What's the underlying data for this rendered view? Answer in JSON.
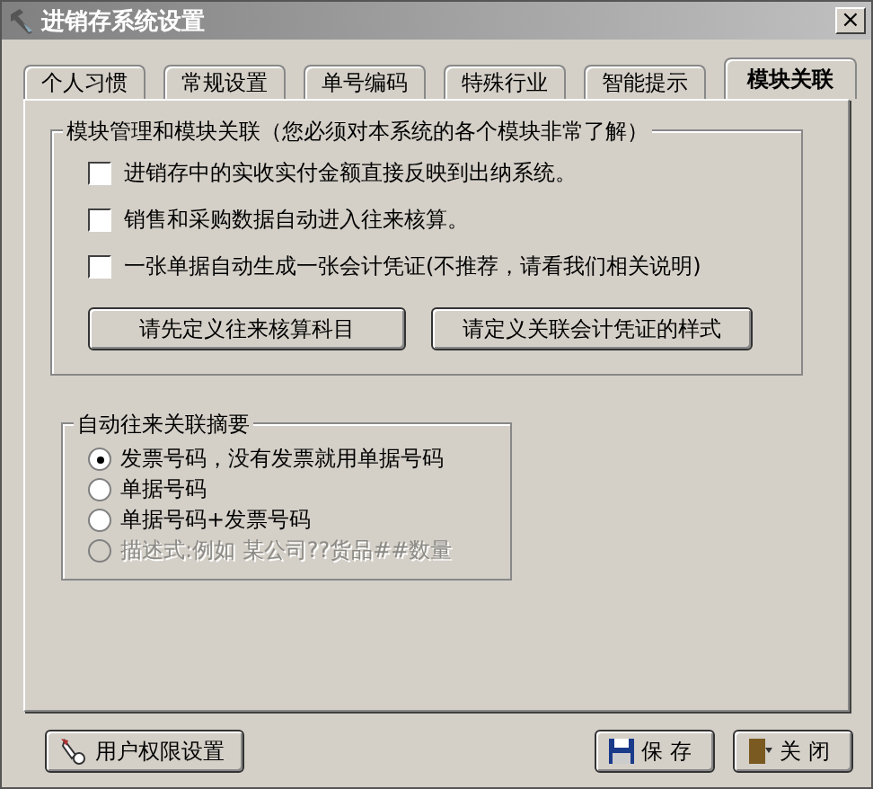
{
  "window": {
    "title": "进销存系统设置",
    "close": "×"
  },
  "tabs": [
    {
      "label": "个人习惯",
      "selected": false
    },
    {
      "label": "常规设置",
      "selected": false
    },
    {
      "label": "单号编码",
      "selected": false
    },
    {
      "label": "特殊行业",
      "selected": false
    },
    {
      "label": "智能提示",
      "selected": false
    },
    {
      "label": "模块关联",
      "selected": true
    }
  ],
  "module_group": {
    "title": "模块管理和模块关联（您必须对本系统的各个模块非常了解）",
    "checkboxes": [
      {
        "label": "进销存中的实收实付金额直接反映到出纳系统。",
        "checked": false
      },
      {
        "label": "销售和采购数据自动进入往来核算。",
        "checked": false
      },
      {
        "label": "一张单据自动生成一张会计凭证(不推荐，请看我们相关说明)",
        "checked": false
      }
    ],
    "buttons": [
      "请先定义往来核算科目",
      "请定义关联会计凭证的样式"
    ]
  },
  "summary_group": {
    "title": "自动往来关联摘要",
    "options": [
      {
        "label": "发票号码，没有发票就用单据号码",
        "selected": true,
        "disabled": false
      },
      {
        "label": "单据号码",
        "selected": false,
        "disabled": false
      },
      {
        "label": "单据号码+发票号码",
        "selected": false,
        "disabled": false
      },
      {
        "label": "描述式:例如 某公司??货品##数量",
        "selected": false,
        "disabled": true
      }
    ]
  },
  "footer": {
    "permissions_button": "用户权限设置",
    "save_button": "保 存",
    "close_button": "关 闭"
  }
}
